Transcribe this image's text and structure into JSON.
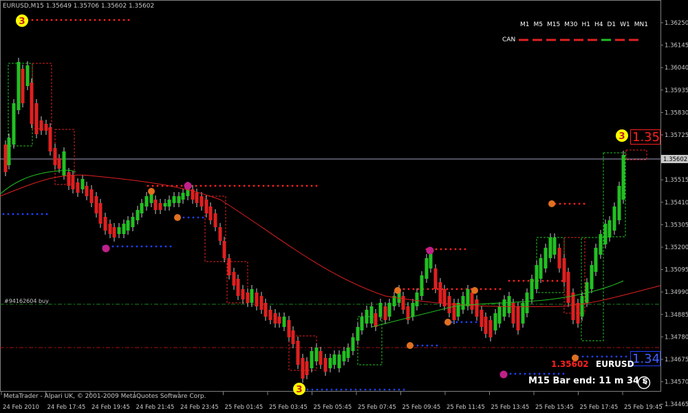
{
  "header": {
    "symbol_tf": "EURUSD,M15",
    "ohlc": "1.35649 1.35706 1.35602 1.35602"
  },
  "timeframes": [
    "M1",
    "M5",
    "M15",
    "M30",
    "H1",
    "H4",
    "D1",
    "W1",
    "MN1"
  ],
  "can": {
    "label": "CAN",
    "statuses": [
      "red",
      "red",
      "red",
      "red",
      "red",
      "red",
      "green",
      "red",
      "red"
    ]
  },
  "price_axis": {
    "labels": [
      "1.36250",
      "1.36145",
      "1.36040",
      "1.35935",
      "1.35830",
      "1.35725",
      "1.35620",
      "1.35515",
      "1.35410",
      "1.35305",
      "1.35200",
      "1.35095",
      "1.34990",
      "1.34885",
      "1.34780",
      "1.34675",
      "1.34570",
      "1.34465"
    ],
    "current": "1.35602"
  },
  "time_axis": {
    "labels": [
      "24 Feb 2010",
      "24 Feb 17:45",
      "24 Feb 19:45",
      "24 Feb 21:45",
      "24 Feb 23:45",
      "25 Feb 01:45",
      "25 Feb 03:45",
      "25 Feb 05:45",
      "25 Feb 07:45",
      "25 Feb 09:45",
      "25 Feb 11:45",
      "25 Feb 13:45",
      "25 Feb 15:45",
      "25 Feb 17:45",
      "25 Feb 19:45"
    ]
  },
  "order_label": "#94162604 buy",
  "big_high_label": "1.35",
  "big_low_label": "1.34",
  "markers": {
    "three": "3"
  },
  "info": {
    "price": "1.35602",
    "symbol": "EURUSD",
    "bar_end": "M15 Bar end: 11 m 34 s"
  },
  "footer": "MetaTrader - Alpari UK, © 2001-2009 MetaQuotes Software Corp.",
  "colors": {
    "bull": "#22c022",
    "bear": "#e02020",
    "ma_red": "#e02020",
    "ma_green": "#22c022",
    "high_dots": "#ff2020",
    "low_dots": "#2040ff",
    "marker_yellow": "#ffff00",
    "marker_orange": "#e07020",
    "marker_magenta": "#c0208a"
  }
}
